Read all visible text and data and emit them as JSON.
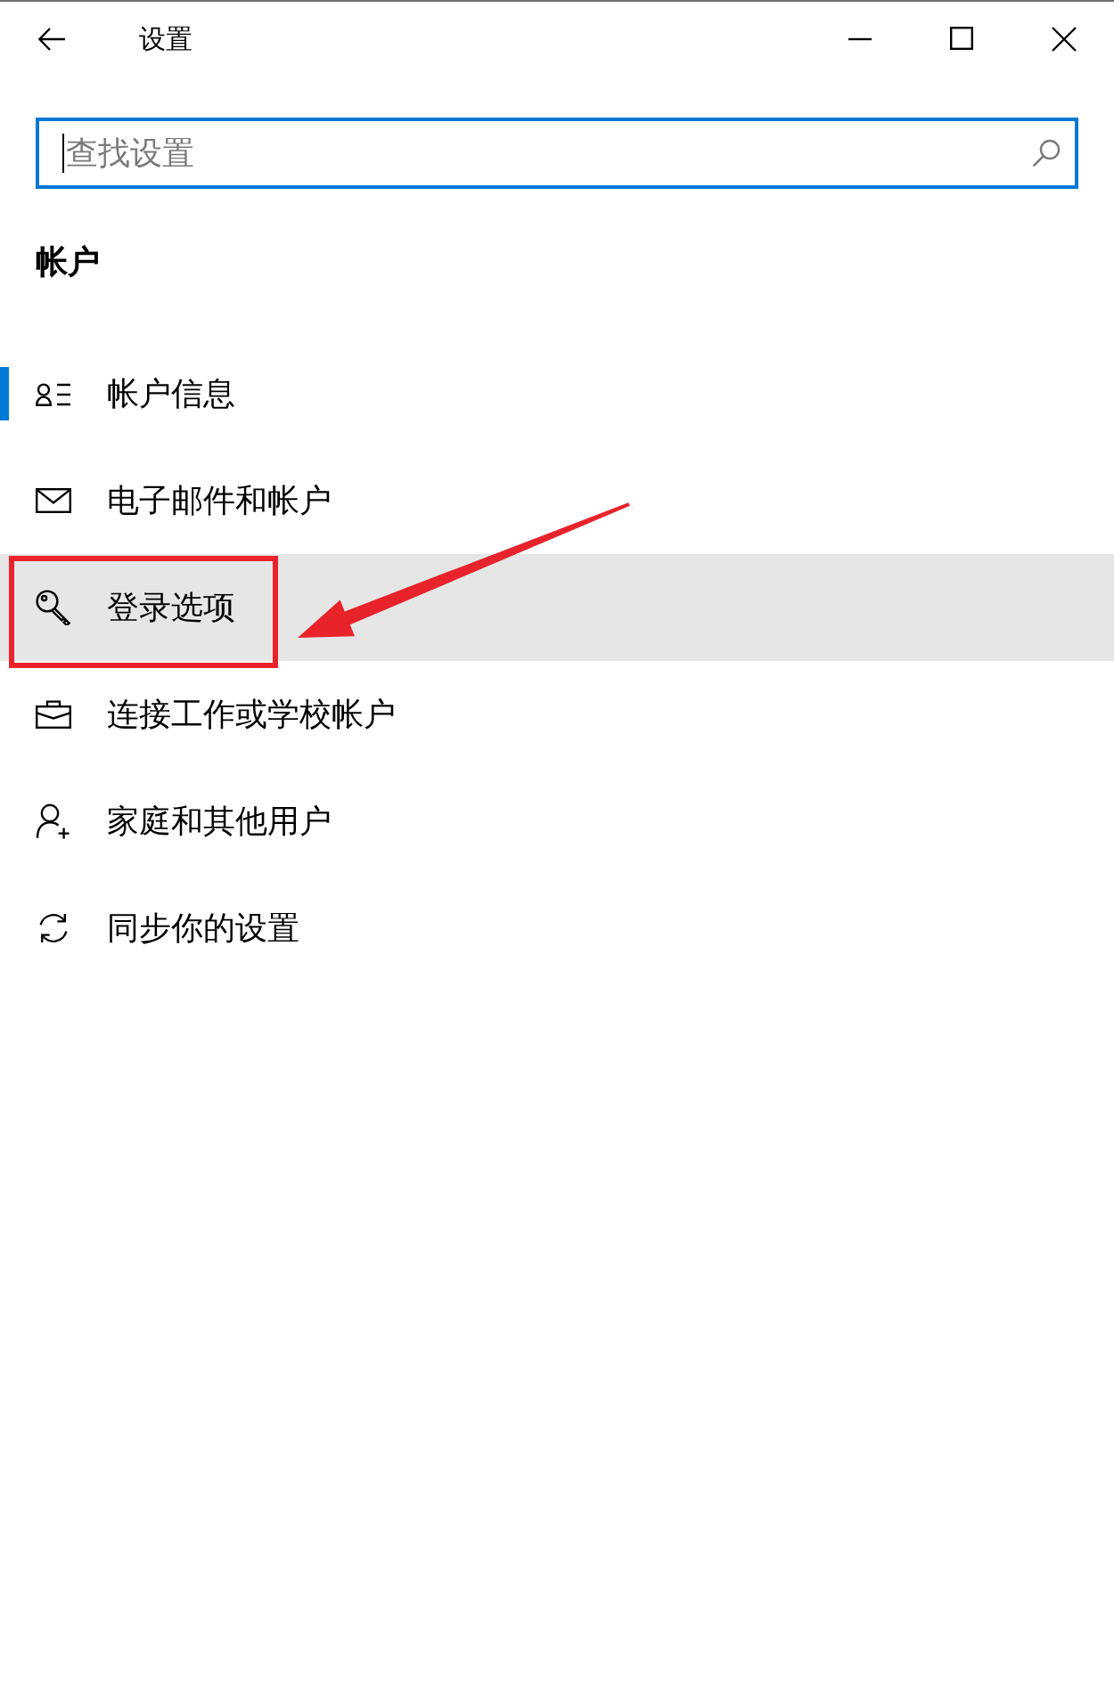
{
  "window": {
    "title": "设置"
  },
  "search": {
    "placeholder": "查找设置",
    "focused": true
  },
  "section": {
    "heading": "帐户"
  },
  "nav_items": [
    {
      "label": "帐户信息",
      "selected": true,
      "hovered": false,
      "annotated": false
    },
    {
      "label": "电子邮件和帐户",
      "selected": false,
      "hovered": false,
      "annotated": false
    },
    {
      "label": "登录选项",
      "selected": false,
      "hovered": true,
      "annotated": true
    },
    {
      "label": "连接工作或学校帐户",
      "selected": false,
      "hovered": false,
      "annotated": false
    },
    {
      "label": "家庭和其他用户",
      "selected": false,
      "hovered": false,
      "annotated": false
    },
    {
      "label": "同步你的设置",
      "selected": false,
      "hovered": false,
      "annotated": false
    }
  ]
}
